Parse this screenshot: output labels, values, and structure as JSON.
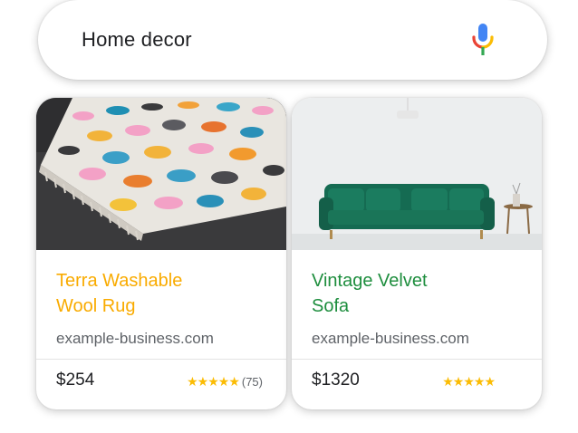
{
  "search": {
    "query": "Home decor",
    "mic_icon": "microphone-icon"
  },
  "colors": {
    "title_yellow": "#f9ab00",
    "title_green": "#1e8e3e",
    "star": "#fbbc04"
  },
  "products": [
    {
      "title_line1": "Terra Washable",
      "title_line2": "Wool Rug",
      "url": "example-business.com",
      "price": "$254",
      "stars": "★★★★★",
      "review_count": "(75)"
    },
    {
      "title_line1": "Vintage Velvet",
      "title_line2": "Sofa",
      "url": "example-business.com",
      "price": "$1320",
      "stars": "★★★★★"
    }
  ]
}
